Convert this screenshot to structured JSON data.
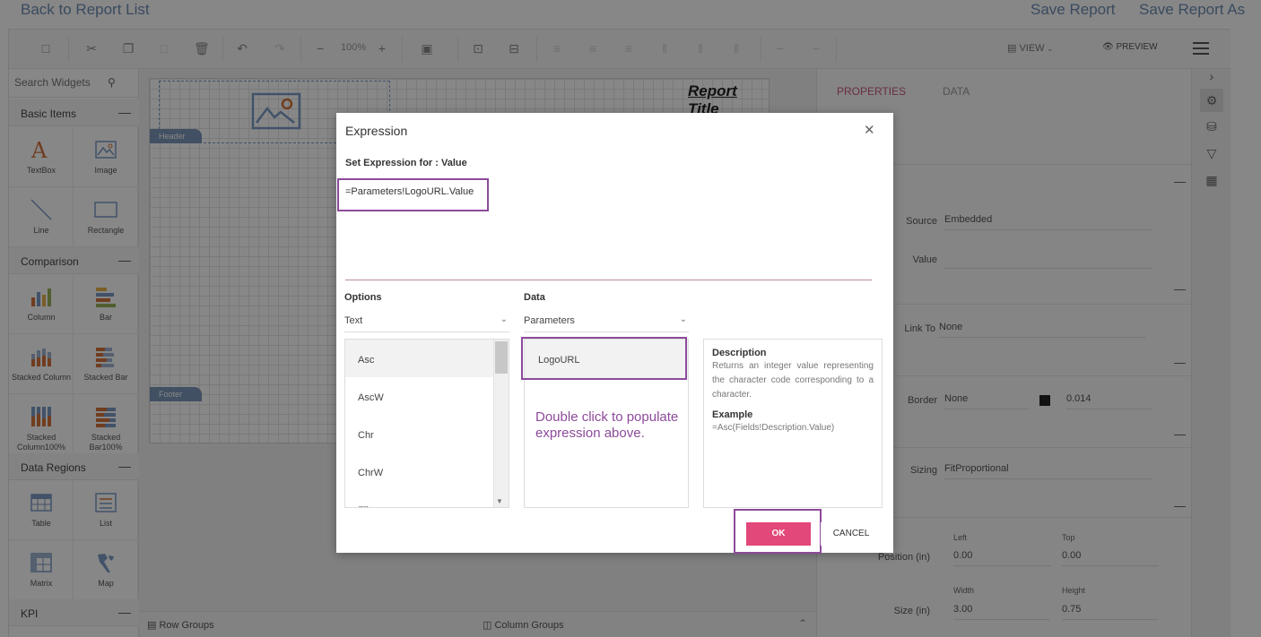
{
  "topbar": {
    "back_label": "Back to Report List",
    "save_label": "Save Report",
    "save_as_label": "Save Report As"
  },
  "toolbar": {
    "zoom": "100%",
    "view_label": "VIEW",
    "preview_label": "PREVIEW"
  },
  "left_panel": {
    "search_placeholder": "Search Widgets",
    "sections": [
      {
        "title": "Basic Items",
        "items": [
          "TextBox",
          "Image",
          "Line",
          "Rectangle"
        ]
      },
      {
        "title": "Comparison",
        "items": [
          "Column",
          "Bar",
          "Stacked Column",
          "Stacked Bar",
          "Stacked Column100%",
          "Stacked Bar100%"
        ]
      },
      {
        "title": "Data Regions",
        "items": [
          "Table",
          "List",
          "Matrix",
          "Map"
        ]
      },
      {
        "title": "KPI",
        "items": []
      }
    ]
  },
  "canvas": {
    "report_title": "Report Title",
    "header_label": "Header",
    "footer_label": "Footer"
  },
  "groups": {
    "row_groups": "Row Groups",
    "column_groups": "Column Groups"
  },
  "properties": {
    "tab_properties": "PROPERTIES",
    "tab_data": "DATA",
    "source_label": "Source",
    "source_value": "Embedded",
    "value_label": "Value",
    "link_to_label": "Link To",
    "link_to_value": "None",
    "border_label": "Border",
    "border_value": "None",
    "border_width": "0.014",
    "sizing_label": "Sizing",
    "sizing_value": "FitProportional",
    "position_label": "Position (in)",
    "left_label": "Left",
    "top_label": "Top",
    "left_value": "0.00",
    "top_value": "0.00",
    "size_label": "Size (in)",
    "width_label": "Width",
    "height_label": "Height",
    "width_value": "3.00",
    "height_value": "0.75"
  },
  "modal": {
    "title": "Expression",
    "subtitle": "Set Expression for : Value",
    "expression": "=Parameters!LogoURL.Value",
    "options_heading": "Options",
    "options_selected": "Text",
    "options_items": [
      "Asc",
      "AscW",
      "Chr",
      "ChrW",
      "Filt"
    ],
    "data_heading": "Data",
    "data_selected": "Parameters",
    "data_items": [
      "LogoURL"
    ],
    "hint": "Double click to populate expression above.",
    "description_heading": "Description",
    "description_text": "Returns an integer value representing the character code corresponding to a character.",
    "example_heading": "Example",
    "example_text": "=Asc(Fields!Description.Value)",
    "ok_label": "OK",
    "cancel_label": "CANCEL"
  },
  "colors": {
    "accent_pink": "#e2487a",
    "highlight_purple": "#8c4a9a",
    "link_blue": "#6f8db3"
  }
}
